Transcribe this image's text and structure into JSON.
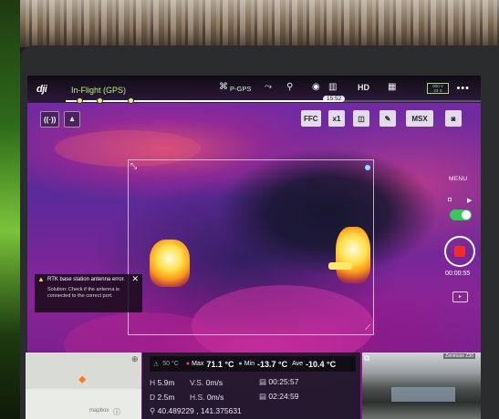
{
  "status_bar": {
    "flight_mode": "In-Flight (GPS)",
    "gps_label": "P-GPS",
    "video_link": "HD",
    "time_bubble": "15:52",
    "battery_top": "000 V",
    "battery_bottom": "23 S"
  },
  "toolbar": {
    "ffc": "FFC",
    "zoom": "x1",
    "msx": "MSX"
  },
  "alert": {
    "title": "RTK base station antenna error.",
    "message": "Solution: Check if the antenna is connected to the correct port."
  },
  "right_panel": {
    "menu": "MENU",
    "record_time": "00:00:55"
  },
  "temperature": {
    "spot": "50 °C",
    "max_label": "Max",
    "max_value": "71.1 °C",
    "min_label": "Min",
    "min_value": "-13.7 °C",
    "ave_label": "Ave",
    "ave_value": "-10.4 °C"
  },
  "telemetry": {
    "h_key": "H",
    "h_val": "5.9m",
    "vs_key": "V.S.",
    "vs_val": "0m/s",
    "d_key": "D",
    "d_val": "2.5m",
    "hs_key": "H.S.",
    "hs_val": "0m/s",
    "flight_time": "00:25:57",
    "remaining_time": "02:24:59",
    "coords": "40.489229 , 141.375631"
  },
  "minimap": {
    "attribution": "mapbox"
  },
  "pip": {
    "camera_label": "Zenmuse Z30"
  },
  "colors": {
    "accent_green": "#b9f57a",
    "record_red": "#ef2d2d",
    "toggle_green": "#37c85a",
    "alert_yellow": "#ffcf2e"
  }
}
